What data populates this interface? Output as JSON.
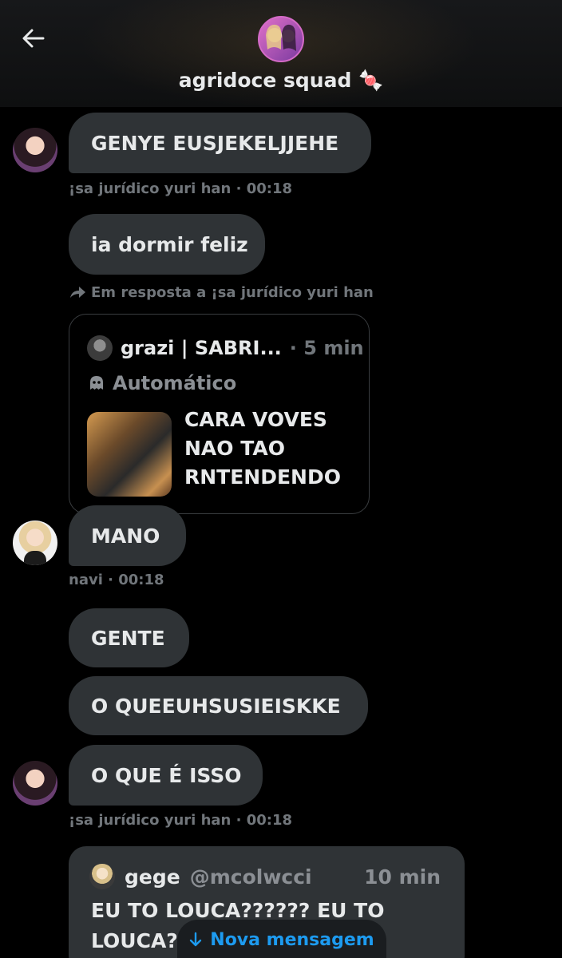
{
  "header": {
    "title": "agridoce squad 🍬",
    "back_icon": "arrow-left-icon"
  },
  "messages": [
    {
      "text": "GENYE EUSJEKELJJEHE"
    },
    {
      "meta": "¡sa jurídico yuri han · 00:18"
    },
    {
      "text": "ia dormir feliz"
    },
    {
      "reply_note": "Em resposta a ¡sa jurídico yuri han"
    },
    {
      "text": "MANO"
    },
    {
      "meta": "navi · 00:18"
    },
    {
      "text": "GENTE"
    },
    {
      "text": "O QUEEUHSUSIEISKKE"
    },
    {
      "text": "O QUE É ISSO"
    },
    {
      "meta": "¡sa jurídico yuri han · 00:18"
    }
  ],
  "quote_card": {
    "name": "grazi | SABRI...",
    "time": "· 5 min",
    "auto_label": "Automático",
    "text": "CARA VOVES NAO TAO RNTENDENDO"
  },
  "card2": {
    "name": "gege",
    "handle": "@mcolwcci",
    "time": "10 min",
    "text": "EU TO LOUCA?????? EU TO LOUCA?"
  },
  "nova_mensagem": {
    "label": "Nova mensagem",
    "color": "#1d9bf0"
  },
  "colors": {
    "bubble": "#2f3336",
    "muted": "#71767b",
    "text": "#e7e9ea"
  }
}
